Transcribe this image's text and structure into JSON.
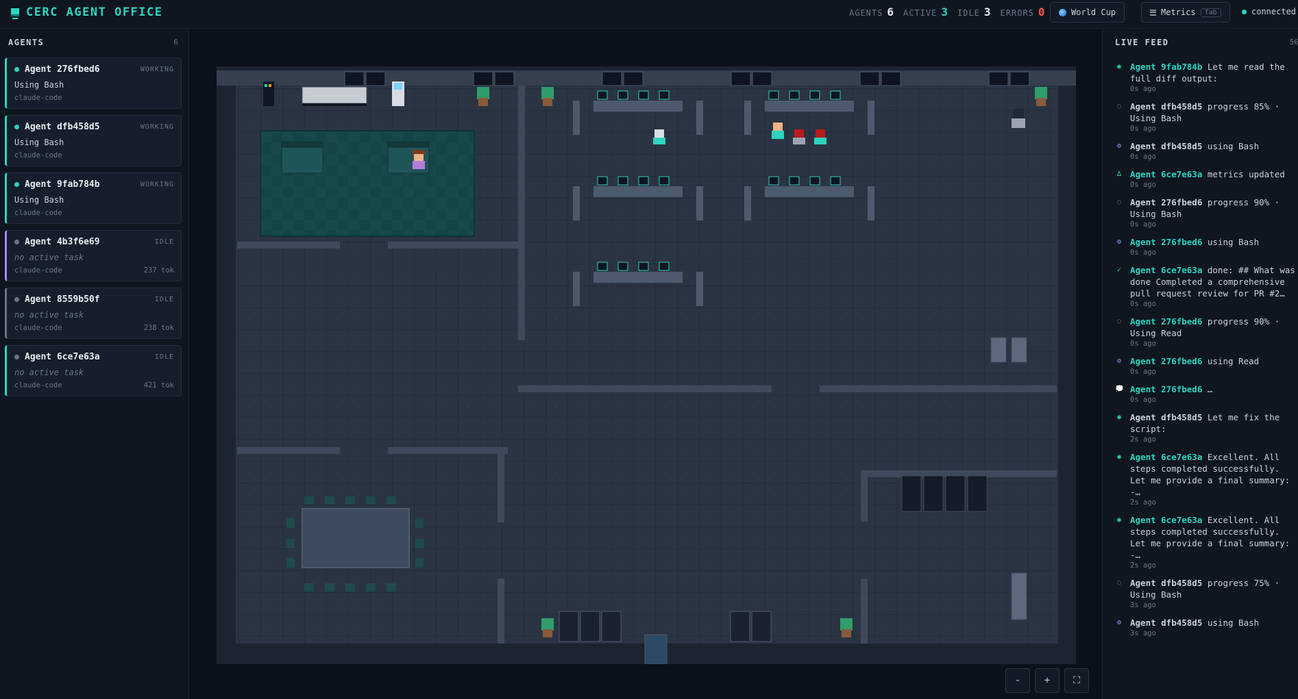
{
  "app": {
    "title": "CERC AGENT OFFICE"
  },
  "stats": {
    "agents_label": "AGENTS",
    "agents_value": "6",
    "active_label": "ACTIVE",
    "active_value": "3",
    "idle_label": "IDLE",
    "idle_value": "3",
    "errors_label": "ERRORS",
    "errors_value": "0"
  },
  "toolbar": {
    "worldcup_label": "World Cup",
    "metrics_label": "Metrics",
    "metrics_key": "Tab",
    "connection_status": "connected"
  },
  "sidebar": {
    "title": "AGENTS",
    "count": "6",
    "agents": [
      {
        "name": "Agent 276fbed6",
        "status": "WORKING",
        "task": "Using Bash",
        "type": "claude-code",
        "tokens": ""
      },
      {
        "name": "Agent dfb458d5",
        "status": "WORKING",
        "task": "Using Bash",
        "type": "claude-code",
        "tokens": ""
      },
      {
        "name": "Agent 9fab784b",
        "status": "WORKING",
        "task": "Using Bash",
        "type": "claude-code",
        "tokens": ""
      },
      {
        "name": "Agent 4b3f6e69",
        "status": "IDLE",
        "task": "no active task",
        "type": "claude-code",
        "tokens": "237 tok"
      },
      {
        "name": "Agent 8559b50f",
        "status": "IDLE",
        "task": "no active task",
        "type": "claude-code",
        "tokens": "238 tok"
      },
      {
        "name": "Agent 6ce7e63a",
        "status": "IDLE",
        "task": "no active task",
        "type": "claude-code",
        "tokens": "421 tok"
      }
    ]
  },
  "zoom": {
    "out_label": "-",
    "in_label": "+",
    "fit_label": "⛶"
  },
  "feed": {
    "title": "LIVE FEED",
    "count": "56",
    "items": [
      {
        "icon": "◉",
        "agent": "Agent 9fab784b",
        "text": " Let me read the full diff output:",
        "time": "0s ago",
        "hl": true,
        "color": "teal"
      },
      {
        "icon": "◌",
        "agent": "Agent dfb458d5",
        "text": " progress 85% · Using Bash",
        "time": "0s ago",
        "hl": false,
        "color": "gray"
      },
      {
        "icon": "⚙",
        "agent": "Agent dfb458d5",
        "text": " using Bash",
        "time": "0s ago",
        "hl": false,
        "color": "purple"
      },
      {
        "icon": "∆",
        "agent": "Agent 6ce7e63a",
        "text": " metrics updated",
        "time": "0s ago",
        "hl": true,
        "color": "teal"
      },
      {
        "icon": "◌",
        "agent": "Agent 276fbed6",
        "text": " progress 90% · Using Bash",
        "time": "0s ago",
        "hl": false,
        "color": "gray"
      },
      {
        "icon": "⚙",
        "agent": "Agent 276fbed6",
        "text": " using Bash",
        "time": "0s ago",
        "hl": true,
        "color": "purple"
      },
      {
        "icon": "✓",
        "agent": "Agent 6ce7e63a",
        "text": " done: ## What was done Completed a comprehensive pull request review for PR #2…",
        "time": "0s ago",
        "hl": true,
        "color": "teal"
      },
      {
        "icon": "◌",
        "agent": "Agent 276fbed6",
        "text": " progress 90% · Using Read",
        "time": "0s ago",
        "hl": true,
        "color": "gray"
      },
      {
        "icon": "⚙",
        "agent": "Agent 276fbed6",
        "text": " using Read",
        "time": "0s ago",
        "hl": true,
        "color": "purple"
      },
      {
        "icon": "💭",
        "agent": "Agent 276fbed6",
        "text": " …",
        "time": "0s ago",
        "hl": true,
        "color": "white"
      },
      {
        "icon": "◉",
        "agent": "Agent dfb458d5",
        "text": " Let me fix the script:",
        "time": "2s ago",
        "hl": false,
        "color": "teal"
      },
      {
        "icon": "◉",
        "agent": "Agent 6ce7e63a",
        "text": " Excellent. All steps completed successfully. Let me provide a final summary: -…",
        "time": "2s ago",
        "hl": true,
        "color": "teal"
      },
      {
        "icon": "◉",
        "agent": "Agent 6ce7e63a",
        "text": " Excellent. All steps completed successfully. Let me provide a final summary: -…",
        "time": "2s ago",
        "hl": true,
        "color": "teal"
      },
      {
        "icon": "◌",
        "agent": "Agent dfb458d5",
        "text": " progress 75% · Using Bash",
        "time": "3s ago",
        "hl": false,
        "color": "gray"
      },
      {
        "icon": "⚙",
        "agent": "Agent dfb458d5",
        "text": " using Bash",
        "time": "3s ago",
        "hl": false,
        "color": "purple"
      }
    ]
  },
  "colors": {
    "accent": "#2dd4bf",
    "error": "#f85149",
    "idle_purple": "#a78bfa",
    "floor": "#2b3442"
  }
}
